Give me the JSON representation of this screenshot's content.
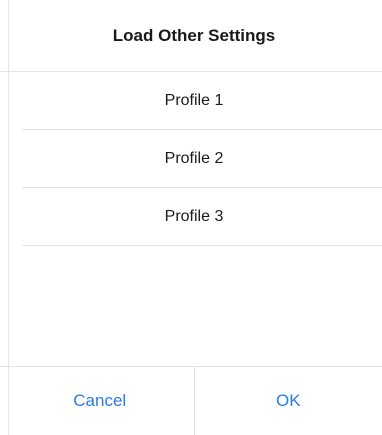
{
  "dialog": {
    "title": "Load Other Settings",
    "profiles": [
      {
        "label": "Profile 1"
      },
      {
        "label": "Profile 2"
      },
      {
        "label": "Profile 3"
      }
    ],
    "buttons": {
      "cancel_label": "Cancel",
      "ok_label": "OK"
    }
  },
  "colors": {
    "accent": "#2a7be4",
    "separator": "#e3e3e3",
    "text": "#1a1a1a"
  }
}
